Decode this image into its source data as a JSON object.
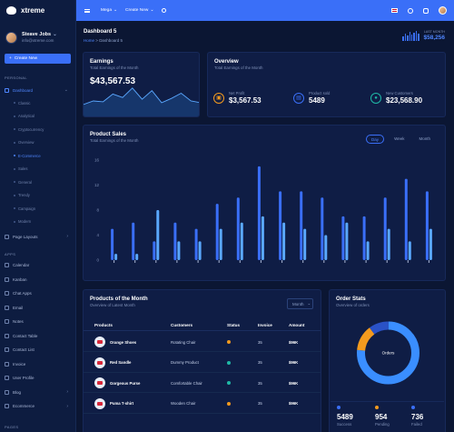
{
  "brand": {
    "name": "xtreme"
  },
  "user": {
    "name": "Steave Jobs",
    "email": "info@xtreme.com"
  },
  "sidebar": {
    "create_label": "Create New",
    "personal_label": "PERSONAL",
    "dashboard_label": "Dashboard",
    "dashboard_sub": [
      "Classic",
      "Analytical",
      "Cryptocurrency",
      "Overview",
      "E-Commerce",
      "Sales",
      "General",
      "Trendy",
      "Campaign",
      "Modern"
    ],
    "page_layouts_label": "Page Layouts",
    "apps_label": "APPS",
    "apps": [
      {
        "label": "Calendar",
        "chev": false
      },
      {
        "label": "Kanban",
        "chev": false
      },
      {
        "label": "Chat Apps",
        "chev": false
      },
      {
        "label": "Email",
        "chev": false
      },
      {
        "label": "Notes",
        "chev": false
      },
      {
        "label": "Contact Table",
        "chev": false
      },
      {
        "label": "Contact List",
        "chev": false
      },
      {
        "label": "Invoice",
        "chev": false
      },
      {
        "label": "User Profile",
        "chev": false
      },
      {
        "label": "Blog",
        "chev": true
      },
      {
        "label": "Ecommerce",
        "chev": true
      }
    ],
    "pages_label": "PAGES"
  },
  "topbar": {
    "mega_label": "Mega",
    "create_label": "Create New"
  },
  "header": {
    "title": "Dashboard 5",
    "breadcrumb_home": "Home",
    "breadcrumb_sep": ">",
    "breadcrumb_current": "Dashboard 5",
    "last_month_label": "LAST MONTH",
    "last_month_value": "$58,256"
  },
  "earnings": {
    "title": "Earnings",
    "subtitle": "Total Earnings of the Month",
    "value": "$43,567.53",
    "sparkline": [
      14,
      18,
      17,
      26,
      22,
      33,
      20,
      30,
      16,
      21,
      27,
      18,
      16
    ]
  },
  "overview": {
    "title": "Overview",
    "subtitle": "Total Earnings of the Month",
    "stats": [
      {
        "label": "Net Profit",
        "value": "$3,567.53",
        "color": "#f39a1e",
        "icon": "wallet-icon",
        "glyph": "▣"
      },
      {
        "label": "Product sold",
        "value": "5489",
        "color": "#3a6ff8",
        "icon": "bag-icon",
        "glyph": "▤"
      },
      {
        "label": "New Customers",
        "value": "$23,568.90",
        "color": "#1fb8a6",
        "icon": "user-icon",
        "glyph": "●"
      }
    ]
  },
  "sales": {
    "title": "Product Sales",
    "subtitle": "Total Earnings of the Month",
    "tabs": [
      "Day",
      "Week",
      "Month"
    ],
    "active_tab": "Day"
  },
  "chart_data": {
    "type": "bar",
    "title": "Product Sales",
    "ylim": [
      0,
      16
    ],
    "yticks": [
      0,
      4,
      8,
      12,
      16
    ],
    "series": [
      {
        "values": [
          5,
          6,
          3,
          6,
          5,
          9,
          10,
          15,
          11,
          11,
          10,
          7,
          7,
          10,
          13,
          11
        ]
      },
      {
        "values": [
          1,
          1,
          8,
          3,
          3,
          5,
          6,
          7,
          6,
          5,
          4,
          6,
          3,
          5,
          3,
          5
        ]
      }
    ],
    "colors": [
      "#3a6ff8",
      "#5aa8ff"
    ]
  },
  "products": {
    "title": "Products of the Month",
    "subtitle": "Overview of Latest Month",
    "filter": "Month",
    "columns": [
      "Products",
      "Customers",
      "Status",
      "Invoice",
      "Amount"
    ],
    "rows": [
      {
        "product": "Orange Shoes",
        "customer": "Rotating Chair",
        "status_color": "#f39a1e",
        "invoice": "35",
        "amount": "$96K"
      },
      {
        "product": "Red Sandle",
        "customer": "Dummy Product",
        "status_color": "#1fb8a6",
        "invoice": "35",
        "amount": "$96K"
      },
      {
        "product": "Gorgeous Purse",
        "customer": "Comfortable Chair",
        "status_color": "#1fb8a6",
        "invoice": "35",
        "amount": "$96K"
      },
      {
        "product": "Puma T-shirt",
        "customer": "Wooden Chair",
        "status_color": "#f39a1e",
        "invoice": "35",
        "amount": "$96K"
      }
    ]
  },
  "orders": {
    "title": "Order Stats",
    "subtitle": "Overview of orders",
    "center_label": "Orders",
    "donut": [
      {
        "value": 5489,
        "color": "#3a8eff"
      },
      {
        "value": 954,
        "color": "#f39a1e"
      },
      {
        "value": 736,
        "color": "#2a52c6"
      }
    ],
    "stats": [
      {
        "value": "5489",
        "label": "Success",
        "color": "#3a6ff8"
      },
      {
        "value": "954",
        "label": "Pending",
        "color": "#f39a1e"
      },
      {
        "value": "736",
        "label": "Failed",
        "color": "#3a6ff8"
      }
    ]
  }
}
